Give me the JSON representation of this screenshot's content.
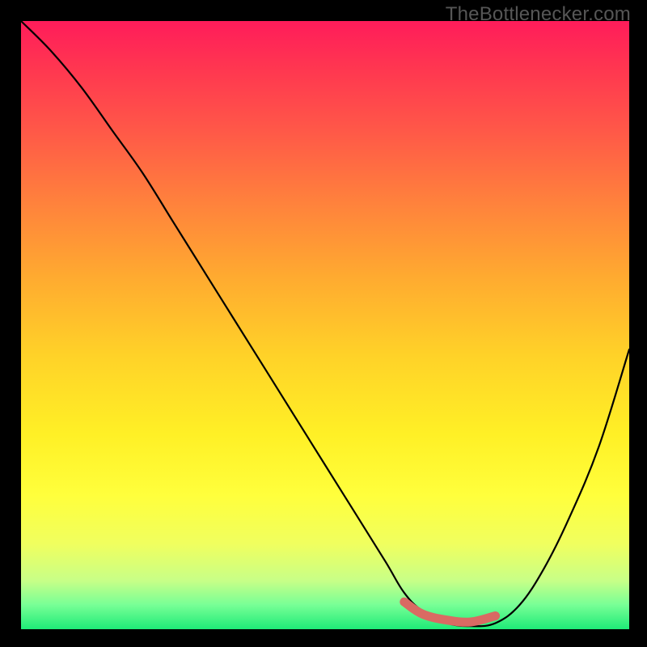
{
  "watermark": "TheBottlenecker.com",
  "chart_data": {
    "type": "line",
    "title": "",
    "xlabel": "",
    "ylabel": "",
    "xlim": [
      0,
      100
    ],
    "ylim": [
      0,
      100
    ],
    "series": [
      {
        "name": "bottleneck-curve",
        "x": [
          0,
          5,
          10,
          15,
          20,
          25,
          30,
          35,
          40,
          45,
          50,
          55,
          60,
          63,
          66,
          70,
          74,
          78,
          82,
          86,
          90,
          95,
          100
        ],
        "y": [
          100,
          95,
          89,
          82,
          75,
          67,
          59,
          51,
          43,
          35,
          27,
          19,
          11,
          6,
          3,
          1,
          0.5,
          1,
          4,
          10,
          18,
          30,
          46
        ]
      }
    ],
    "highlight_segment": {
      "name": "optimal-range",
      "x": [
        63,
        66,
        70,
        74,
        78
      ],
      "y": [
        4.5,
        2.5,
        1.5,
        1.2,
        2.2
      ],
      "color": "#d96a63"
    },
    "gradient_stops": [
      {
        "pct": 0,
        "color": "#ff1c5a"
      },
      {
        "pct": 18,
        "color": "#ff5848"
      },
      {
        "pct": 42,
        "color": "#ffaa30"
      },
      {
        "pct": 68,
        "color": "#fff126"
      },
      {
        "pct": 86,
        "color": "#f0ff5f"
      },
      {
        "pct": 100,
        "color": "#1eeb78"
      }
    ]
  }
}
